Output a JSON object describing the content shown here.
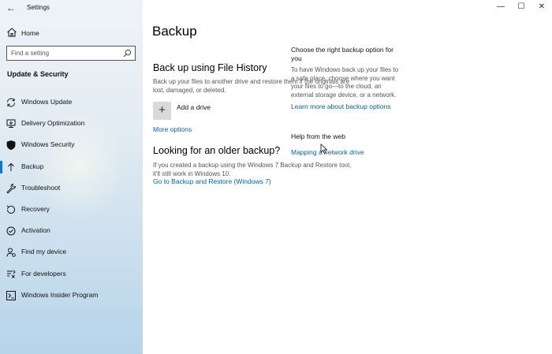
{
  "window": {
    "title": "Settings",
    "back_glyph": "←",
    "controls": {
      "minimize": "—",
      "maximize": "☐",
      "close": "✕"
    }
  },
  "sidebar": {
    "home_label": "Home",
    "search": {
      "placeholder": "Find a setting",
      "value": ""
    },
    "section_title": "Update & Security",
    "items": [
      {
        "label": "Windows Update",
        "icon": "sync-icon",
        "active": false
      },
      {
        "label": "Delivery Optimization",
        "icon": "delivery-optimization-icon",
        "active": false
      },
      {
        "label": "Windows Security",
        "icon": "shield-icon",
        "active": false
      },
      {
        "label": "Backup",
        "icon": "backup-arrow-icon",
        "active": true
      },
      {
        "label": "Troubleshoot",
        "icon": "wrench-icon",
        "active": false
      },
      {
        "label": "Recovery",
        "icon": "recovery-icon",
        "active": false
      },
      {
        "label": "Activation",
        "icon": "check-circle-icon",
        "active": false
      },
      {
        "label": "Find my device",
        "icon": "person-pin-icon",
        "active": false
      },
      {
        "label": "For developers",
        "icon": "developer-tools-icon",
        "active": false
      },
      {
        "label": "Windows Insider Program",
        "icon": "insider-icon",
        "active": false
      }
    ]
  },
  "main": {
    "title": "Backup",
    "file_history": {
      "heading": "Back up using File History",
      "description": "Back up your files to another drive and restore them if the originals are lost, damaged, or deleted.",
      "add_drive_label": "Add a drive",
      "add_drive_glyph": "+",
      "more_options": "More options"
    },
    "older_backup": {
      "heading": "Looking for an older backup?",
      "description": "If you created a backup using the Windows 7 Backup and Restore tool, it'll still work in Windows 10.",
      "link": "Go to Backup and Restore (Windows 7)"
    }
  },
  "side_panel": {
    "choose_heading": "Choose the right backup option for you",
    "choose_text": "To have Windows back up your files to a safe place, choose where you want your files to go—to the cloud, an external storage device, or a network.",
    "learn_more": "Learn more about backup options",
    "help_heading": "Help from the web",
    "help_link": "Mapping a network drive"
  },
  "colors": {
    "accent": "#0078d7",
    "link": "#0063b1",
    "secondary_text": "#555555"
  }
}
